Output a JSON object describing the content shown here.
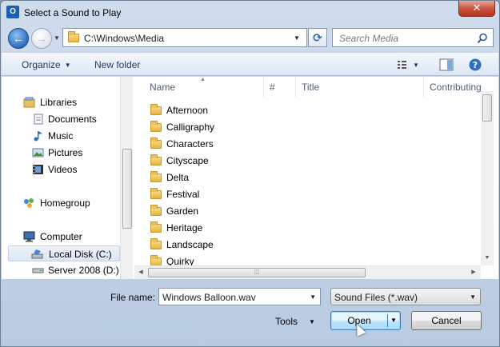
{
  "window": {
    "title": "Select a Sound to Play",
    "app_icon_letter": "O",
    "close_label": "✕"
  },
  "nav": {
    "back_glyph": "←",
    "forward_glyph": "→",
    "address": "C:\\Windows\\Media",
    "refresh_glyph": "⟳",
    "search_placeholder": "Search Media"
  },
  "toolbar": {
    "organize_label": "Organize",
    "new_folder_label": "New folder"
  },
  "navpane": {
    "items": [
      {
        "label": "Libraries",
        "icon": "libraries-icon"
      },
      {
        "label": "Documents",
        "icon": "documents-icon"
      },
      {
        "label": "Music",
        "icon": "music-icon"
      },
      {
        "label": "Pictures",
        "icon": "pictures-icon"
      },
      {
        "label": "Videos",
        "icon": "videos-icon"
      },
      {
        "label": "Homegroup",
        "icon": "homegroup-icon"
      },
      {
        "label": "Computer",
        "icon": "computer-icon"
      },
      {
        "label": "Local Disk (C:)",
        "icon": "drive-icon",
        "selected": true
      },
      {
        "label": "Server 2008  (D:)",
        "icon": "drive-icon"
      }
    ]
  },
  "files": {
    "columns": [
      "Name",
      "#",
      "Title",
      "Contributing"
    ],
    "items": [
      "Afternoon",
      "Calligraphy",
      "Characters",
      "Cityscape",
      "Delta",
      "Festival",
      "Garden",
      "Heritage",
      "Landscape",
      "Quirky"
    ]
  },
  "bottom": {
    "file_name_label": "File name:",
    "file_name_value": "Windows Balloon.wav",
    "filter_value": "Sound Files (*.wav)",
    "tools_label": "Tools",
    "open_label": "Open",
    "cancel_label": "Cancel"
  },
  "colors": {
    "accent": "#3c7fb1",
    "close": "#c7503c"
  }
}
